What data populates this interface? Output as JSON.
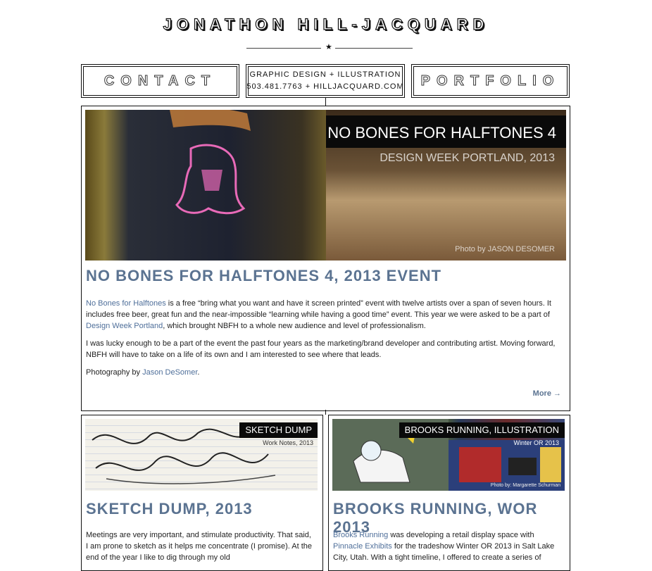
{
  "header": {
    "title": "JONATHON HILL-JACQUARD"
  },
  "nav": {
    "contact_label": "CONTACT",
    "info_line1": "GRAPHIC DESIGN + ILLUSTRATION",
    "info_line2": "503.481.7763  +  HILLJACQUARD.COM",
    "portfolio_label": "PORTFOLIO"
  },
  "featured_post": {
    "banner_title": "NO BONES FOR HALFTONES 4",
    "banner_subtitle": "DESIGN WEEK PORTLAND, 2013",
    "photo_credit": "Photo by JASON DESOMER",
    "title": "NO BONES FOR HALFTONES 4, 2013 EVENT",
    "p1_link": "No Bones for Halftones",
    "p1_text_a": " is a free “bring what you want and have it screen printed” event with twelve artists over a span of seven hours. It includes free beer, great fun and the near-impossible “learning while having a good time” event. This year we were asked to be a part of ",
    "p1_link2": "Design Week Portland",
    "p1_text_b": ", which brought NBFH to a whole new audience and level of professionalism.",
    "p2": "I was lucky enough to be a part of the event the past four years as the marketing/brand developer and contributing artist. Moving forward, NBFH will have to take on a life of its own and I am interested to see where that leads.",
    "p3_text": "Photography by ",
    "p3_link": "Jason DeSomer",
    "p3_end": ".",
    "more_label": "More →"
  },
  "posts": [
    {
      "tag": "SKETCH DUMP",
      "tag_sub": "Work Notes, 2013",
      "title": "SKETCH DUMP, 2013",
      "body": "Meetings are very important, and stimulate productivity. That said, I am prone to sketch as it helps me concentrate (I promise). At the end of the year I like to dig through my old"
    },
    {
      "tag": "BROOKS RUNNING, ILLUSTRATION",
      "tag_sub": "Winter OR 2013",
      "photo_credit": "Photo by: Margarette Schurman",
      "title": "BROOKS RUNNING, WOR 2013",
      "body_link": "Brooks Running",
      "body_text_a": " was developing a retail display space with ",
      "body_link2": "Pinnacle Exhibits",
      "body_text_b": " for the tradeshow Winter OR 2013 in Salt Lake City, Utah. With a tight timeline, I offered to create a series of"
    }
  ]
}
